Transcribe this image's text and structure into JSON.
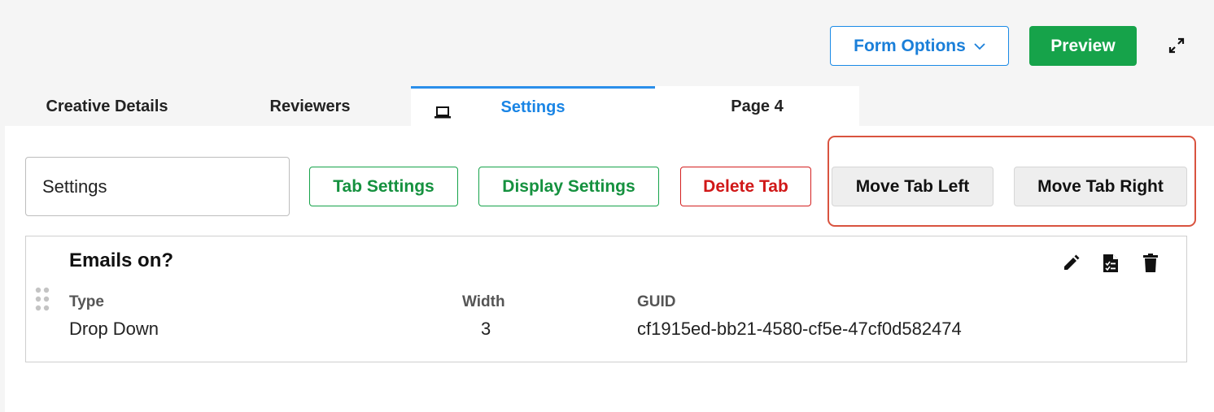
{
  "toolbar": {
    "form_options_label": "Form Options",
    "preview_label": "Preview",
    "expand_icon": "expand-icon"
  },
  "tabs": [
    {
      "label": "Creative Details",
      "active": false
    },
    {
      "label": "Reviewers",
      "active": false
    },
    {
      "label": "Settings",
      "active": true,
      "icon": "laptop-icon"
    },
    {
      "label": "Page 4",
      "active": false
    }
  ],
  "tab_editor": {
    "tab_name_value": "Settings",
    "tab_settings_label": "Tab Settings",
    "display_settings_label": "Display Settings",
    "delete_tab_label": "Delete Tab",
    "move_left_label": "Move Tab Left",
    "move_right_label": "Move Tab Right"
  },
  "field": {
    "title": "Emails on?",
    "type_label": "Type",
    "type_value": "Drop Down",
    "width_label": "Width",
    "width_value": "3",
    "guid_label": "GUID",
    "guid_value": "cf1915ed-bb21-4580-cf5e-47cf0d582474",
    "icons": [
      "pencil-icon",
      "document-checklist-icon",
      "trash-icon"
    ]
  },
  "colors": {
    "accent_blue": "#1a85e5",
    "preview_green": "#16a34a",
    "delete_red": "#d01818",
    "highlight": "#d9533f"
  }
}
